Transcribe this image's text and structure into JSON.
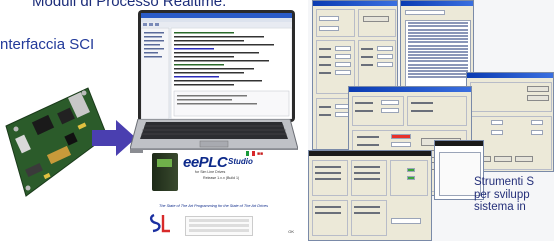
{
  "header": {
    "title": "Moduli di Processo Realtime."
  },
  "sci": {
    "label": "nterfaccia SCI"
  },
  "product": {
    "logo": "eePLC",
    "logo_suffix": "Studio",
    "subtitle": "for Sim Line Drives",
    "version": "Release 1.x.x  (Build 1)",
    "tagline": "The State of The Art Programming for the State of The Art Drives",
    "ok_label": "OK"
  },
  "tools": {
    "line1": "Strumenti S",
    "line2": "per svilupp",
    "line3": "sistema in"
  },
  "colors": {
    "title": "#1c2d7a",
    "label": "#223a9a",
    "arrow": "#4a3fb0",
    "logo": "#0d2a8a",
    "titlebar": "#0a3bb2"
  }
}
